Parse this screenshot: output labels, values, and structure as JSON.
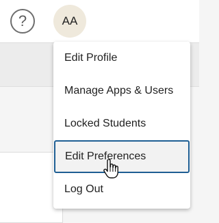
{
  "header": {
    "help_glyph": "?",
    "avatar_initials": "AA"
  },
  "user_menu": {
    "items": [
      {
        "label": "Edit Profile"
      },
      {
        "label": "Manage Apps & Users"
      },
      {
        "label": "Locked Students"
      },
      {
        "label": "Edit Preferences",
        "state": "hovered"
      },
      {
        "label": "Log Out"
      }
    ]
  },
  "colors": {
    "focus_border": "#1e5e93",
    "avatar_bg": "#efe9dc"
  },
  "cursor": {
    "icon": "hand-pointer-icon"
  }
}
